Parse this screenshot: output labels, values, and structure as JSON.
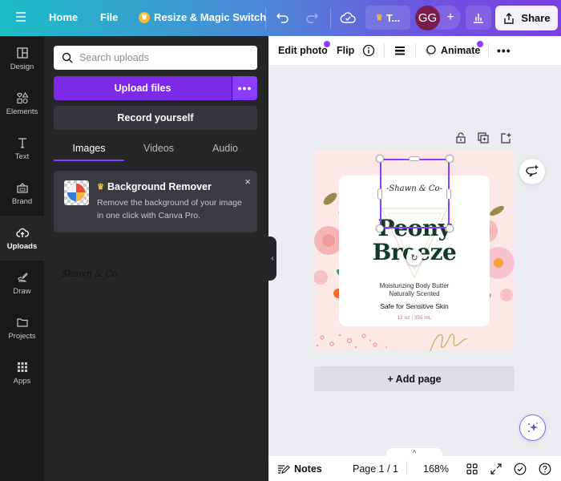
{
  "topbar": {
    "menu_icon": "hamburger-icon",
    "home": "Home",
    "file": "File",
    "resize": "Resize & Magic Switch",
    "undo_icon": "undo-icon",
    "redo_icon": "redo-icon",
    "saved_icon": "cloud-check-icon",
    "team_label": "T...",
    "avatar_initials": "GG",
    "add_user": "+",
    "insights_icon": "bar-chart-icon",
    "share": "Share",
    "gradient_start": "#1bbdc7",
    "gradient_end": "#7a3fe0"
  },
  "rail": {
    "items": [
      {
        "label": "Design",
        "icon": "layout-icon"
      },
      {
        "label": "Elements",
        "icon": "shapes-icon"
      },
      {
        "label": "Text",
        "icon": "text-icon"
      },
      {
        "label": "Brand",
        "icon": "brand-kit-icon"
      },
      {
        "label": "Uploads",
        "icon": "cloud-upload-icon",
        "active": true
      },
      {
        "label": "Draw",
        "icon": "pen-icon"
      },
      {
        "label": "Projects",
        "icon": "folder-icon"
      },
      {
        "label": "Apps",
        "icon": "grid-icon"
      }
    ]
  },
  "panel": {
    "search_placeholder": "Search uploads",
    "upload_files": "Upload files",
    "upload_more": "•••",
    "record": "Record yourself",
    "tabs": [
      "Images",
      "Videos",
      "Audio"
    ],
    "active_tab": "Images",
    "promo": {
      "title": "Background Remover",
      "description": "Remove the background of your image in one click with Canva Pro.",
      "close": "×"
    },
    "uploaded_item": "Shawn & Co."
  },
  "context_toolbar": {
    "edit_photo": "Edit photo",
    "flip": "Flip",
    "info_icon": "info-icon",
    "position_icon": "position-icon",
    "animate": "Animate",
    "more": "•••"
  },
  "canvas": {
    "brand": "-Shawn & Co-",
    "title_line1": "Peony",
    "title_line2": "Breeze",
    "subtitle1": "Moisturizing Body Butter",
    "subtitle2": "Naturally Scented",
    "tagline": "Safe for Sensitive Skin",
    "size": "12 oz | 355 mL",
    "add_page": "+ Add page",
    "accent": "#8b3dff"
  },
  "footer": {
    "notes": "Notes",
    "page": "Page 1 / 1",
    "zoom": "168%",
    "expand_caret": "^"
  }
}
